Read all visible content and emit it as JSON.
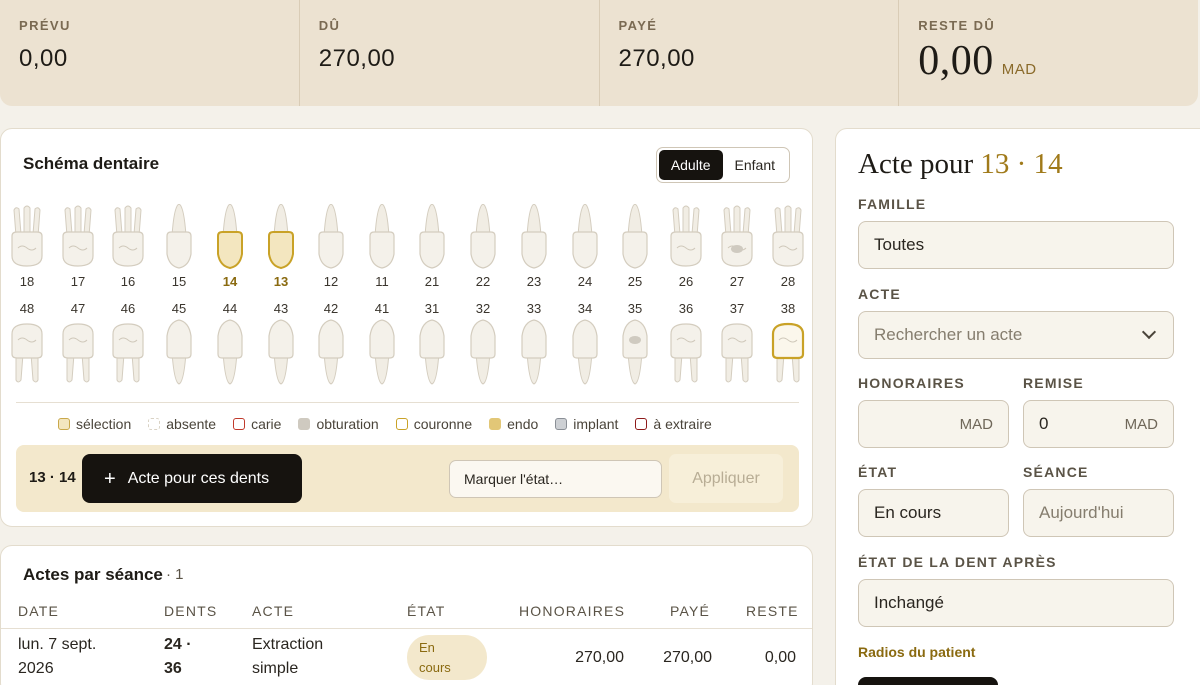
{
  "summary": [
    {
      "label": "PRÉVU",
      "value": "0,00"
    },
    {
      "label": "DÛ",
      "value": "270,00"
    },
    {
      "label": "PAYÉ",
      "value": "270,00"
    },
    {
      "label": "RESTE DÛ",
      "value": "0,00",
      "unit": "MAD"
    }
  ],
  "chart": {
    "title": "Schéma dentaire",
    "toggle": {
      "adult": "Adulte",
      "child": "Enfant",
      "active": "adult"
    },
    "upper": [
      {
        "num": "18",
        "state": "none",
        "roots": 3
      },
      {
        "num": "17",
        "state": "none",
        "roots": 3
      },
      {
        "num": "16",
        "state": "none",
        "roots": 3
      },
      {
        "num": "15",
        "state": "none",
        "roots": 1
      },
      {
        "num": "14",
        "state": "selected",
        "roots": 1
      },
      {
        "num": "13",
        "state": "selected",
        "roots": 1
      },
      {
        "num": "12",
        "state": "none",
        "roots": 1
      },
      {
        "num": "11",
        "state": "none",
        "roots": 1
      },
      {
        "num": "21",
        "state": "none",
        "roots": 1
      },
      {
        "num": "22",
        "state": "none",
        "roots": 1
      },
      {
        "num": "23",
        "state": "none",
        "roots": 1
      },
      {
        "num": "24",
        "state": "none",
        "roots": 1
      },
      {
        "num": "25",
        "state": "none",
        "roots": 1
      },
      {
        "num": "26",
        "state": "none",
        "roots": 3
      },
      {
        "num": "27",
        "state": "obturation",
        "roots": 3
      },
      {
        "num": "28",
        "state": "none",
        "roots": 3
      }
    ],
    "lower": [
      {
        "num": "48",
        "state": "none",
        "roots": 2
      },
      {
        "num": "47",
        "state": "none",
        "roots": 2
      },
      {
        "num": "46",
        "state": "none",
        "roots": 2
      },
      {
        "num": "45",
        "state": "none",
        "roots": 1
      },
      {
        "num": "44",
        "state": "none",
        "roots": 1
      },
      {
        "num": "43",
        "state": "none",
        "roots": 1
      },
      {
        "num": "42",
        "state": "none",
        "roots": 1
      },
      {
        "num": "41",
        "state": "none",
        "roots": 1
      },
      {
        "num": "31",
        "state": "none",
        "roots": 1
      },
      {
        "num": "32",
        "state": "none",
        "roots": 1
      },
      {
        "num": "33",
        "state": "none",
        "roots": 1
      },
      {
        "num": "34",
        "state": "none",
        "roots": 1
      },
      {
        "num": "35",
        "state": "obturation",
        "roots": 1
      },
      {
        "num": "36",
        "state": "none",
        "roots": 2
      },
      {
        "num": "37",
        "state": "none",
        "roots": 2
      },
      {
        "num": "38",
        "state": "couronne",
        "roots": 2
      }
    ],
    "legend": [
      {
        "label": "sélection",
        "fill": "#f3e6bf",
        "border": "#c9a84a",
        "dashed": false
      },
      {
        "label": "absente",
        "fill": "transparent",
        "border": "#d9d2c4",
        "dashed": true
      },
      {
        "label": "carie",
        "fill": "#ffffff",
        "border": "#c0392b",
        "dashed": false
      },
      {
        "label": "obturation",
        "fill": "#cfcac0",
        "border": "#cfcac0",
        "dashed": false
      },
      {
        "label": "couronne",
        "fill": "#ffffff",
        "border": "#c9a227",
        "dashed": false
      },
      {
        "label": "endo",
        "fill": "#e2c777",
        "border": "#e2c777",
        "dashed": false
      },
      {
        "label": "implant",
        "fill": "#cdd0d4",
        "border": "#8a8f96",
        "dashed": false
      },
      {
        "label": "à extraire",
        "fill": "#ffffff",
        "border": "#8e1a1a",
        "dashed": false
      }
    ],
    "action_bar": {
      "teeth": "13 · 14",
      "primary_label": "Acte pour ces dents",
      "state_placeholder": "Marquer l'état…",
      "apply_label": "Appliquer"
    }
  },
  "seances": {
    "title": "Actes par séance",
    "count": "· 1",
    "columns": {
      "date": "DATE",
      "dents": "DENTS",
      "acte": "ACTE",
      "etat": "ÉTAT",
      "honoraires": "HONORAIRES",
      "paye": "PAYÉ",
      "reste": "RESTE"
    },
    "rows": [
      {
        "date_l1": "lun. 7 sept.",
        "date_l2": "2026",
        "dents_l1": "24 ·",
        "dents_l2": "36",
        "acte_l1": "Extraction",
        "acte_l2": "simple",
        "etat_l1": "En",
        "etat_l2": "cours",
        "honoraires": "270,00",
        "paye": "270,00",
        "reste": "0,00"
      }
    ]
  },
  "side": {
    "title_prefix": "Acte pour",
    "title_teeth": "13 · 14",
    "famille_label": "FAMILLE",
    "famille_value": "Toutes",
    "acte_label": "ACTE",
    "acte_placeholder": "Rechercher un acte",
    "honoraires_label": "HONORAIRES",
    "honoraires_unit": "MAD",
    "remise_label": "REMISE",
    "remise_value": "0",
    "remise_unit": "MAD",
    "etat_label": "ÉTAT",
    "etat_value": "En cours",
    "seance_label": "SÉANCE",
    "seance_placeholder": "Aujourd'hui",
    "etat_dent_label": "ÉTAT DE LA DENT APRÈS",
    "etat_dent_value": "Inchangé",
    "radios_link": "Radios du patient"
  }
}
